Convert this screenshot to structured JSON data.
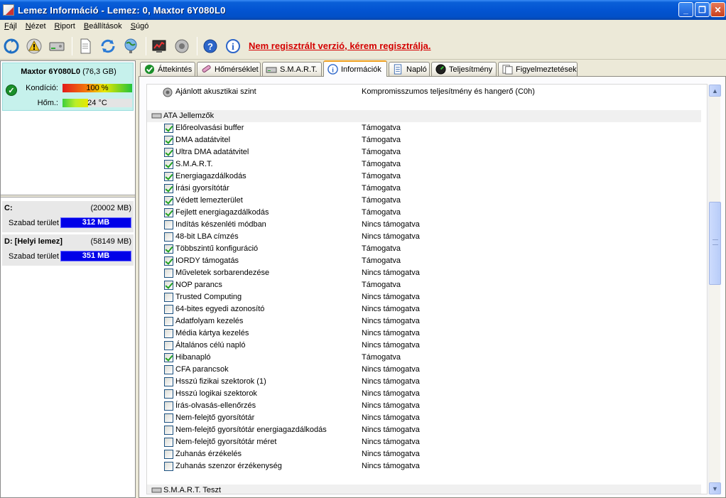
{
  "window": {
    "title": "Lemez Információ - Lemez: 0, Maxtor 6Y080L0",
    "min_glyph": "_",
    "max_glyph": "❐",
    "close_glyph": "✕"
  },
  "menu": [
    "Fájl",
    "Nézet",
    "Riport",
    "Beállítások",
    "Súgó"
  ],
  "toolbar": {
    "icons": [
      "refresh-icon",
      "warning-icon",
      "disk-icon",
      "document-icon",
      "sync-icon",
      "network-icon",
      "chart-icon",
      "speaker-icon",
      "help-icon",
      "info-icon"
    ],
    "unregistered_text": "Nem regisztrált verzió, kérem regisztrálja."
  },
  "disk": {
    "model": "Maxtor 6Y080L0",
    "capacity": "(76,3 GB)",
    "health_label": "Kondíció:",
    "health_value": "100 %",
    "health_percent": 100,
    "temp_label": "Hőm.:",
    "temp_value": "24 °C",
    "temp_fill_percent": 0.37
  },
  "drives": [
    {
      "name": "C:",
      "size": "(20002 MB)",
      "free_label": "Szabad terület",
      "free_value": "312 MB"
    },
    {
      "name": "D: [Helyi lemez]",
      "size": "(58149 MB)",
      "free_label": "Szabad terület",
      "free_value": "351 MB"
    }
  ],
  "tabs": [
    {
      "label": "Áttekintés",
      "icon": "check-icon"
    },
    {
      "label": "Hőmérséklet",
      "icon": "thermometer-icon"
    },
    {
      "label": "S.M.A.R.T.",
      "icon": "disk-icon"
    },
    {
      "label": "Információk",
      "icon": "info-icon",
      "active": true
    },
    {
      "label": "Napló",
      "icon": "log-icon"
    },
    {
      "label": "Teljesítmény",
      "icon": "gauge-icon"
    },
    {
      "label": "Figyelmeztetések",
      "icon": "alerts-icon"
    }
  ],
  "list": {
    "top_item": {
      "name": "Ajánlott akusztikai szint",
      "value": "Kompromisszumos teljesítmény és hangerő (C0h)"
    },
    "group_ata": "ATA Jellemzők",
    "group_smart": "S.M.A.R.T. Teszt",
    "features": [
      {
        "name": "Előreolvasási buffer",
        "checked": true,
        "value": "Támogatva"
      },
      {
        "name": "DMA adatátvitel",
        "checked": true,
        "value": "Támogatva"
      },
      {
        "name": "Ultra DMA adatátvitel",
        "checked": true,
        "value": "Támogatva"
      },
      {
        "name": "S.M.A.R.T.",
        "checked": true,
        "value": "Támogatva"
      },
      {
        "name": "Energiagazdálkodás",
        "checked": true,
        "value": "Támogatva"
      },
      {
        "name": "Írási gyorsítótár",
        "checked": true,
        "value": "Támogatva"
      },
      {
        "name": "Védett lemezterület",
        "checked": true,
        "value": "Támogatva"
      },
      {
        "name": "Fejlett energiagazdálkodás",
        "checked": true,
        "value": "Támogatva"
      },
      {
        "name": "Indítás készenléti módban",
        "checked": false,
        "value": "Nincs támogatva"
      },
      {
        "name": "48-bit LBA címzés",
        "checked": false,
        "value": "Nincs támogatva"
      },
      {
        "name": "Többszintű konfiguráció",
        "checked": true,
        "value": "Támogatva"
      },
      {
        "name": "IORDY támogatás",
        "checked": true,
        "value": "Támogatva"
      },
      {
        "name": "Műveletek sorbarendezése",
        "checked": false,
        "value": "Nincs támogatva"
      },
      {
        "name": "NOP parancs",
        "checked": true,
        "value": "Támogatva"
      },
      {
        "name": "Trusted Computing",
        "checked": false,
        "value": "Nincs támogatva"
      },
      {
        "name": "64-bites egyedi azonosító",
        "checked": false,
        "value": "Nincs támogatva"
      },
      {
        "name": "Adatfolyam kezelés",
        "checked": false,
        "value": "Nincs támogatva"
      },
      {
        "name": "Média kártya kezelés",
        "checked": false,
        "value": "Nincs támogatva"
      },
      {
        "name": "Általános célú napló",
        "checked": false,
        "value": "Nincs támogatva"
      },
      {
        "name": "Hibanapló",
        "checked": true,
        "value": "Támogatva"
      },
      {
        "name": "CFA parancsok",
        "checked": false,
        "value": "Nincs támogatva"
      },
      {
        "name": "Hsszú fizikai szektorok (1)",
        "checked": false,
        "value": "Nincs támogatva"
      },
      {
        "name": "Hsszú logikai szektorok",
        "checked": false,
        "value": "Nincs támogatva"
      },
      {
        "name": "Írás-olvasás-ellenőrzés",
        "checked": false,
        "value": "Nincs támogatva"
      },
      {
        "name": "Nem-felejtő gyorsítótár",
        "checked": false,
        "value": "Nincs támogatva"
      },
      {
        "name": "Nem-felejtő gyorsítótár energiagazdálkodás",
        "checked": false,
        "value": "Nincs támogatva"
      },
      {
        "name": "Nem-felejtő gyorsítótár méret",
        "checked": false,
        "value": "Nincs támogatva"
      },
      {
        "name": "Zuhanás érzékelés",
        "checked": false,
        "value": "Nincs támogatva"
      },
      {
        "name": "Zuhanás szenzor érzékenység",
        "checked": false,
        "value": "Nincs támogatva"
      }
    ]
  },
  "scrollbar": {
    "up_glyph": "▲",
    "down_glyph": "▼"
  }
}
